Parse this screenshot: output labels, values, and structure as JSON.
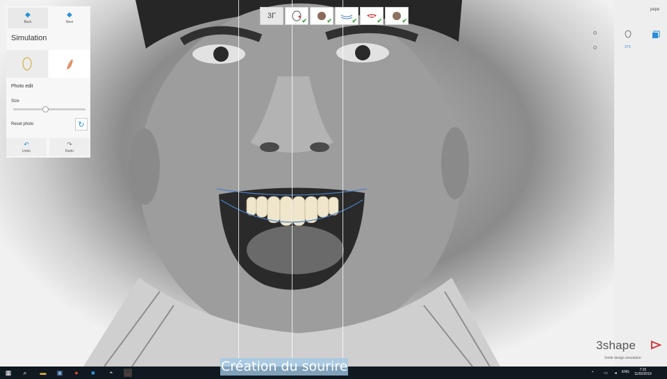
{
  "toolbar": {
    "back_label": "Back",
    "next_label": "Next"
  },
  "panel": {
    "title": "Simulation",
    "photo_edit_label": "Photo edit",
    "size_label": "Size",
    "size_value": 0.45,
    "reset_label": "Reset photo",
    "undo_label": "Undo",
    "redo_label": "Redo"
  },
  "steps": [
    {
      "name": "3shape-logo-step",
      "glyph": "3Γ",
      "checked": false
    },
    {
      "name": "step-face",
      "checked": true
    },
    {
      "name": "step-profile",
      "checked": true
    },
    {
      "name": "step-alignment",
      "checked": true
    },
    {
      "name": "step-smile",
      "checked": true
    },
    {
      "name": "step-face-2",
      "checked": true
    }
  ],
  "right_panel": {
    "user": "pepe",
    "view_label": "3T3"
  },
  "brand": {
    "name": "3shape",
    "subtitle": "Smile design simulation"
  },
  "overlay": {
    "caption": "Création du sourire"
  },
  "taskbar": {
    "lang": "ENG",
    "time": "7:15",
    "date": "11/02/2019"
  },
  "colors": {
    "accent": "#2a8fd6",
    "check": "#3aa53a",
    "caption_bg": "#a0c8e6",
    "taskbar": "#101820"
  }
}
